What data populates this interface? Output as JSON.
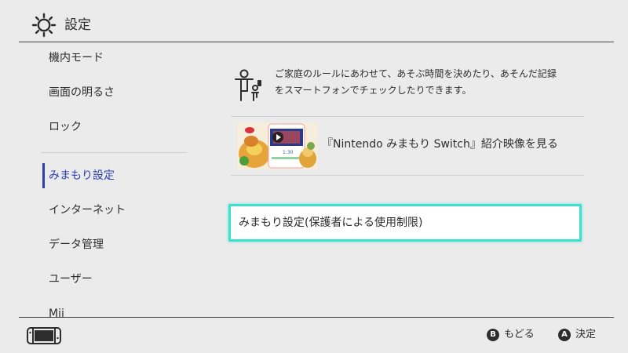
{
  "header": {
    "title": "設定",
    "icon": "gear-icon"
  },
  "sidebar": {
    "items": [
      {
        "label": "機内モード"
      },
      {
        "label": "画面の明るさ"
      },
      {
        "label": "ロック"
      },
      {
        "label": "みまもり設定",
        "active": true
      },
      {
        "label": "インターネット"
      },
      {
        "label": "データ管理"
      },
      {
        "label": "ユーザー"
      },
      {
        "label": "Mii"
      }
    ]
  },
  "main": {
    "description_line1": "ご家庭のルールにあわせて、あそぶ時間を決めたり、あそんだ記録",
    "description_line2": "をスマートフォンでチェックしたりできます。",
    "video_label": "『Nintendo みまもり Switch』紹介映像を見る",
    "parental_button_label": "みまもり設定(保護者による使用制限)",
    "thumbnail_time": "1:30"
  },
  "footer": {
    "back_button_glyph": "B",
    "back_label": "もどる",
    "ok_button_glyph": "A",
    "ok_label": "決定"
  },
  "colors": {
    "background": "#ebebeb",
    "accent_blue": "#2b3fb3",
    "focus_cyan": "#3be0cf",
    "text": "#2d2d2d"
  }
}
